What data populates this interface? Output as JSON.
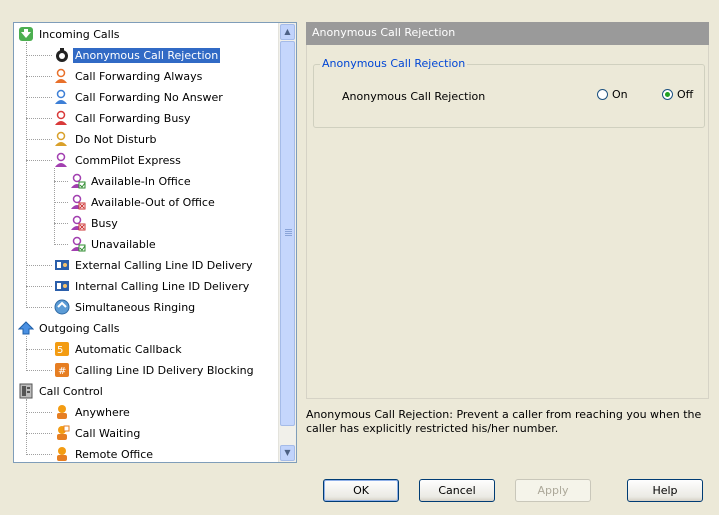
{
  "tree": {
    "items": [
      {
        "label": "Incoming Calls",
        "icon": "incoming-calls-icon",
        "level": 0
      },
      {
        "label": "Anonymous Call Rejection",
        "icon": "anonymous-call-rejection-icon",
        "level": 1,
        "selected": true
      },
      {
        "label": "Call Forwarding Always",
        "icon": "call-forwarding-always-icon",
        "level": 1
      },
      {
        "label": "Call Forwarding No Answer",
        "icon": "call-forwarding-no-answer-icon",
        "level": 1
      },
      {
        "label": "Call Forwarding Busy",
        "icon": "call-forwarding-busy-icon",
        "level": 1
      },
      {
        "label": "Do Not Disturb",
        "icon": "do-not-disturb-icon",
        "level": 1
      },
      {
        "label": "CommPilot Express",
        "icon": "commpilot-express-icon",
        "level": 1
      },
      {
        "label": "Available-In Office",
        "icon": "available-in-office-icon",
        "level": 2
      },
      {
        "label": "Available-Out of Office",
        "icon": "available-out-of-office-icon",
        "level": 2
      },
      {
        "label": "Busy",
        "icon": "busy-icon",
        "level": 2
      },
      {
        "label": "Unavailable",
        "icon": "unavailable-icon",
        "level": 2
      },
      {
        "label": "External Calling Line ID Delivery",
        "icon": "external-clid-icon",
        "level": 1
      },
      {
        "label": "Internal Calling Line ID Delivery",
        "icon": "internal-clid-icon",
        "level": 1
      },
      {
        "label": "Simultaneous Ringing",
        "icon": "simultaneous-ringing-icon",
        "level": 1
      },
      {
        "label": "Outgoing Calls",
        "icon": "outgoing-calls-icon",
        "level": 0
      },
      {
        "label": "Automatic Callback",
        "icon": "automatic-callback-icon",
        "level": 1
      },
      {
        "label": "Calling Line ID Delivery Blocking",
        "icon": "clid-blocking-icon",
        "level": 1
      },
      {
        "label": "Call Control",
        "icon": "call-control-icon",
        "level": 0
      },
      {
        "label": "Anywhere",
        "icon": "anywhere-icon",
        "level": 1
      },
      {
        "label": "Call Waiting",
        "icon": "call-waiting-icon",
        "level": 1
      },
      {
        "label": "Remote Office",
        "icon": "remote-office-icon",
        "level": 1
      }
    ]
  },
  "panel": {
    "header": "Anonymous Call Rejection",
    "group_title": "Anonymous Call Rejection",
    "option_label": "Anonymous Call Rejection",
    "on_label": "On",
    "off_label": "Off",
    "selected": "Off"
  },
  "description": "Anonymous Call Rejection: Prevent a caller from reaching you when the caller has explicitly restricted his/her number.",
  "buttons": {
    "ok": "OK",
    "cancel": "Cancel",
    "apply": "Apply",
    "help": "Help"
  },
  "colors": {
    "selection": "#316ac5",
    "header_bg": "#9a9a9a",
    "group_title": "#0046d5"
  }
}
